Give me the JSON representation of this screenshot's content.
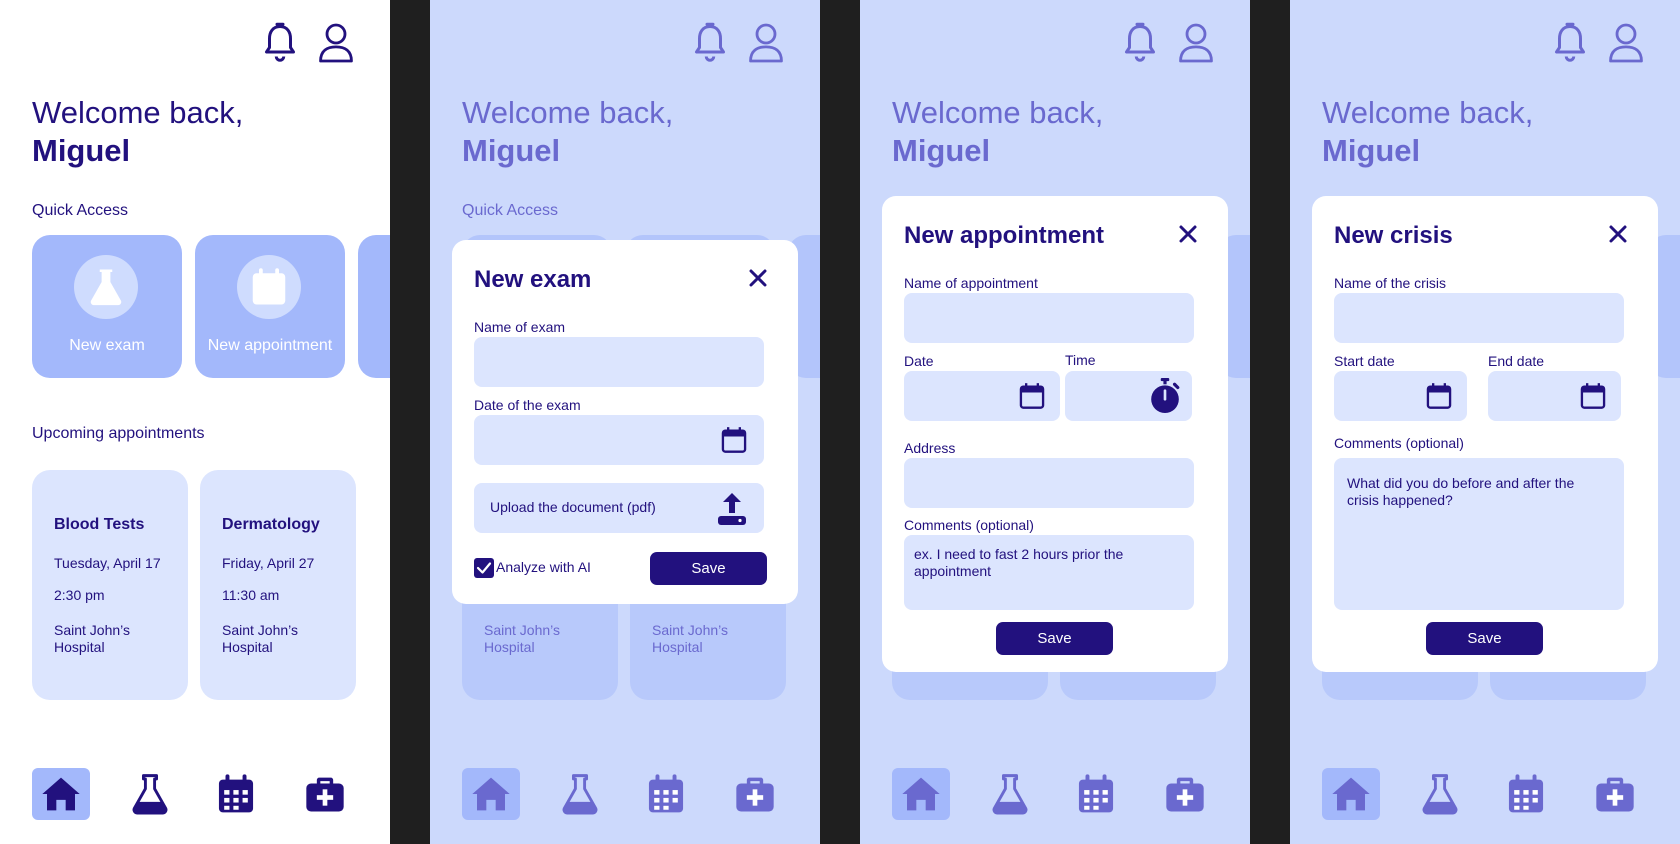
{
  "colors": {
    "primary": "#22117e",
    "card": "#a3b8fb",
    "light": "#dce5fe",
    "overlay": "#ccd9fc"
  },
  "icons": {
    "bell": "bell-icon",
    "profile": "user-icon",
    "flask": "flask-icon",
    "calendar": "calendar-icon",
    "home": "home-icon",
    "medkit": "medical-kit-icon",
    "stopwatch": "stopwatch-icon",
    "upload": "upload-icon",
    "close": "close-icon",
    "check": "check-icon"
  },
  "home": {
    "welcome": "Welcome back,",
    "user_name": "Miguel",
    "quick_access_label": "Quick Access",
    "quick_access": [
      {
        "label": "New exam"
      },
      {
        "label": "New appointment"
      }
    ],
    "upcoming_label": "Upcoming appointments",
    "appointments": [
      {
        "title": "Blood Tests",
        "date": "Tuesday, April 17",
        "time": "2:30 pm",
        "place": "Saint John’s Hospital"
      },
      {
        "title": "Dermatology",
        "date": "Friday, April 27",
        "time": "11:30 am",
        "place": "Saint John’s Hospital"
      }
    ]
  },
  "exam_modal": {
    "title": "New exam",
    "name_label": "Name of exam",
    "date_label": "Date of the exam",
    "upload_label": "Upload the document (pdf)",
    "ai_label": "Analyze with AI",
    "ai_checked": true,
    "save": "Save"
  },
  "appointment_modal": {
    "title": "New appointment",
    "name_label": "Name of appointment",
    "date_label": "Date",
    "time_label": "Time",
    "address_label": "Address",
    "comments_label": "Comments (optional)",
    "comments_placeholder": "ex. I need to fast 2 hours prior the appointment",
    "save": "Save"
  },
  "crisis_modal": {
    "title": "New crisis",
    "name_label": "Name of the crisis",
    "start_label": "Start date",
    "end_label": "End date",
    "comments_label": "Comments (optional)",
    "comments_placeholder": "What did you do before and after the crisis happened?",
    "save": "Save"
  }
}
